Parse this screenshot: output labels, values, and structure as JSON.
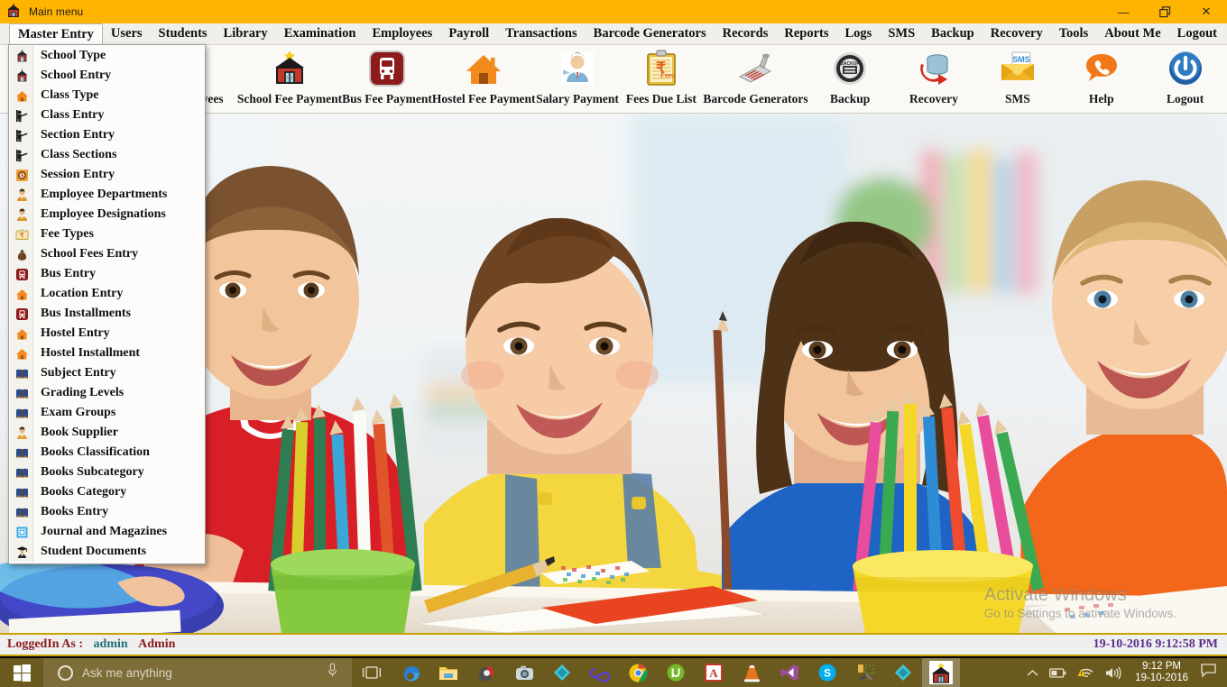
{
  "window": {
    "title": "Main menu",
    "icon": "school-house-icon",
    "controls": {
      "minimize": "—",
      "restore": "❐",
      "close": "✕"
    },
    "titlebar_color": "#FFB400"
  },
  "menubar": {
    "items": [
      {
        "label": "Master Entry",
        "active": true
      },
      {
        "label": "Users",
        "active": false
      },
      {
        "label": "Students",
        "active": false
      },
      {
        "label": "Library",
        "active": false
      },
      {
        "label": "Examination",
        "active": false
      },
      {
        "label": "Employees",
        "active": false
      },
      {
        "label": "Payroll",
        "active": false
      },
      {
        "label": "Transactions",
        "active": false
      },
      {
        "label": "Barcode Generators",
        "active": false
      },
      {
        "label": "Records",
        "active": false
      },
      {
        "label": "Reports",
        "active": false
      },
      {
        "label": "Logs",
        "active": false
      },
      {
        "label": "SMS",
        "active": false
      },
      {
        "label": "Backup",
        "active": false
      },
      {
        "label": "Recovery",
        "active": false
      },
      {
        "label": "Tools",
        "active": false
      },
      {
        "label": "About Me",
        "active": false
      },
      {
        "label": "Logout",
        "active": false
      }
    ]
  },
  "toolbar": {
    "buttons": [
      {
        "label": "Employees",
        "icon": "employee-person-icon",
        "partially_hidden": true
      },
      {
        "label": "School Fee Payment",
        "icon": "school-house-icon"
      },
      {
        "label": "Bus Fee Payment",
        "icon": "bus-icon"
      },
      {
        "label": "Hostel Fee Payment",
        "icon": "hostel-home-icon"
      },
      {
        "label": "Salary Payment",
        "icon": "businessman-icon"
      },
      {
        "label": "Fees Due List",
        "icon": "fees-clipboard-icon"
      },
      {
        "label": "Barcode Generators",
        "icon": "barcode-scanner-icon"
      },
      {
        "label": "Backup",
        "icon": "backup-disc-icon"
      },
      {
        "label": "Recovery",
        "icon": "database-recovery-icon"
      },
      {
        "label": "SMS",
        "icon": "sms-envelope-icon"
      },
      {
        "label": "Help",
        "icon": "help-phone-icon"
      },
      {
        "label": "Logout",
        "icon": "power-logout-icon"
      }
    ]
  },
  "dropdown": {
    "owner": "Master Entry",
    "items": [
      {
        "label": "School Type",
        "icon": "school-house-icon"
      },
      {
        "label": "School Entry",
        "icon": "school-house-icon"
      },
      {
        "label": "Class Type",
        "icon": "orange-home-icon"
      },
      {
        "label": "Class Entry",
        "icon": "presenter-icon"
      },
      {
        "label": "Section Entry",
        "icon": "presenter-icon"
      },
      {
        "label": "Class Sections",
        "icon": "presenter-icon"
      },
      {
        "label": "Session Entry",
        "icon": "session-clock-icon"
      },
      {
        "label": "Employee Departments",
        "icon": "employee-person-icon"
      },
      {
        "label": "Employee Designations",
        "icon": "employee-person-icon"
      },
      {
        "label": "Fee Types",
        "icon": "fees-card-icon"
      },
      {
        "label": "School Fees Entry",
        "icon": "money-bag-icon"
      },
      {
        "label": "Bus Entry",
        "icon": "bus-icon"
      },
      {
        "label": "Location Entry",
        "icon": "orange-home-icon"
      },
      {
        "label": "Bus Installments",
        "icon": "bus-icon"
      },
      {
        "label": "Hostel Entry",
        "icon": "orange-home-icon"
      },
      {
        "label": "Hostel Installment",
        "icon": "orange-home-icon"
      },
      {
        "label": "Subject Entry",
        "icon": "book-icon"
      },
      {
        "label": "Grading Levels",
        "icon": "book-icon"
      },
      {
        "label": "Exam Groups",
        "icon": "book-icon"
      },
      {
        "label": "Book Supplier",
        "icon": "supplier-person-icon"
      },
      {
        "label": "Books Classification",
        "icon": "book-icon"
      },
      {
        "label": "Books Subcategory",
        "icon": "book-icon"
      },
      {
        "label": "Books Category",
        "icon": "book-icon"
      },
      {
        "label": "Books Entry",
        "icon": "book-icon"
      },
      {
        "label": "Journal and Magazines",
        "icon": "journal-icon"
      },
      {
        "label": "Student Documents",
        "icon": "graduate-icon"
      }
    ]
  },
  "desktop": {
    "watermark": {
      "line1": "Activate Windows",
      "line2": "Go to Settings to activate Windows."
    },
    "photo_description": "Four smiling school children at a desk with colored pencils and notebooks"
  },
  "statusbar": {
    "logged_in_label": "LoggedIn As :",
    "username": "admin",
    "role": "Admin",
    "datetime": "19-10-2016 9:12:58 PM",
    "accent_color": "#C8A200"
  },
  "taskbar": {
    "background_color": "#6B5A1E",
    "start_icon": "windows-start-icon",
    "search_placeholder": "Ask me anything",
    "cortana_icon": "cortana-circle-icon",
    "mic_icon": "microphone-icon",
    "taskview_icon": "task-view-icon",
    "apps": [
      {
        "name": "Microsoft Edge",
        "icon": "edge-icon",
        "active": false
      },
      {
        "name": "File Explorer",
        "icon": "file-explorer-icon",
        "active": false
      },
      {
        "name": "Photo Viewer",
        "icon": "photo-app-icon",
        "active": false
      },
      {
        "name": "Camera App",
        "icon": "camera-app-icon",
        "active": false
      },
      {
        "name": "Everything",
        "icon": "teal-diamond-icon",
        "active": false
      },
      {
        "name": "Infinity App",
        "icon": "infinity-icon",
        "active": false
      },
      {
        "name": "Google Chrome",
        "icon": "chrome-icon",
        "active": false
      },
      {
        "name": "uTorrent",
        "icon": "utorrent-icon",
        "active": false
      },
      {
        "name": "Adobe Acrobat Reader",
        "icon": "acrobat-icon",
        "active": false
      },
      {
        "name": "VLC Media Player",
        "icon": "vlc-cone-icon",
        "active": false
      },
      {
        "name": "Visual Studio",
        "icon": "visual-studio-icon",
        "active": false
      },
      {
        "name": "Skype",
        "icon": "skype-icon",
        "active": false
      },
      {
        "name": "Build Tools",
        "icon": "build-tools-icon",
        "active": false
      },
      {
        "name": "Everything 2",
        "icon": "teal-diamond-icon",
        "active": false
      },
      {
        "name": "School Management",
        "icon": "school-house-icon",
        "active": true
      }
    ],
    "tray": {
      "chevron_icon": "chevron-up-icon",
      "battery_icon": "battery-icon",
      "network_icon": "wifi-warning-icon",
      "volume_icon": "speaker-icon",
      "clock_time": "9:12 PM",
      "clock_date": "19-10-2016",
      "action_center_icon": "notification-icon"
    }
  }
}
